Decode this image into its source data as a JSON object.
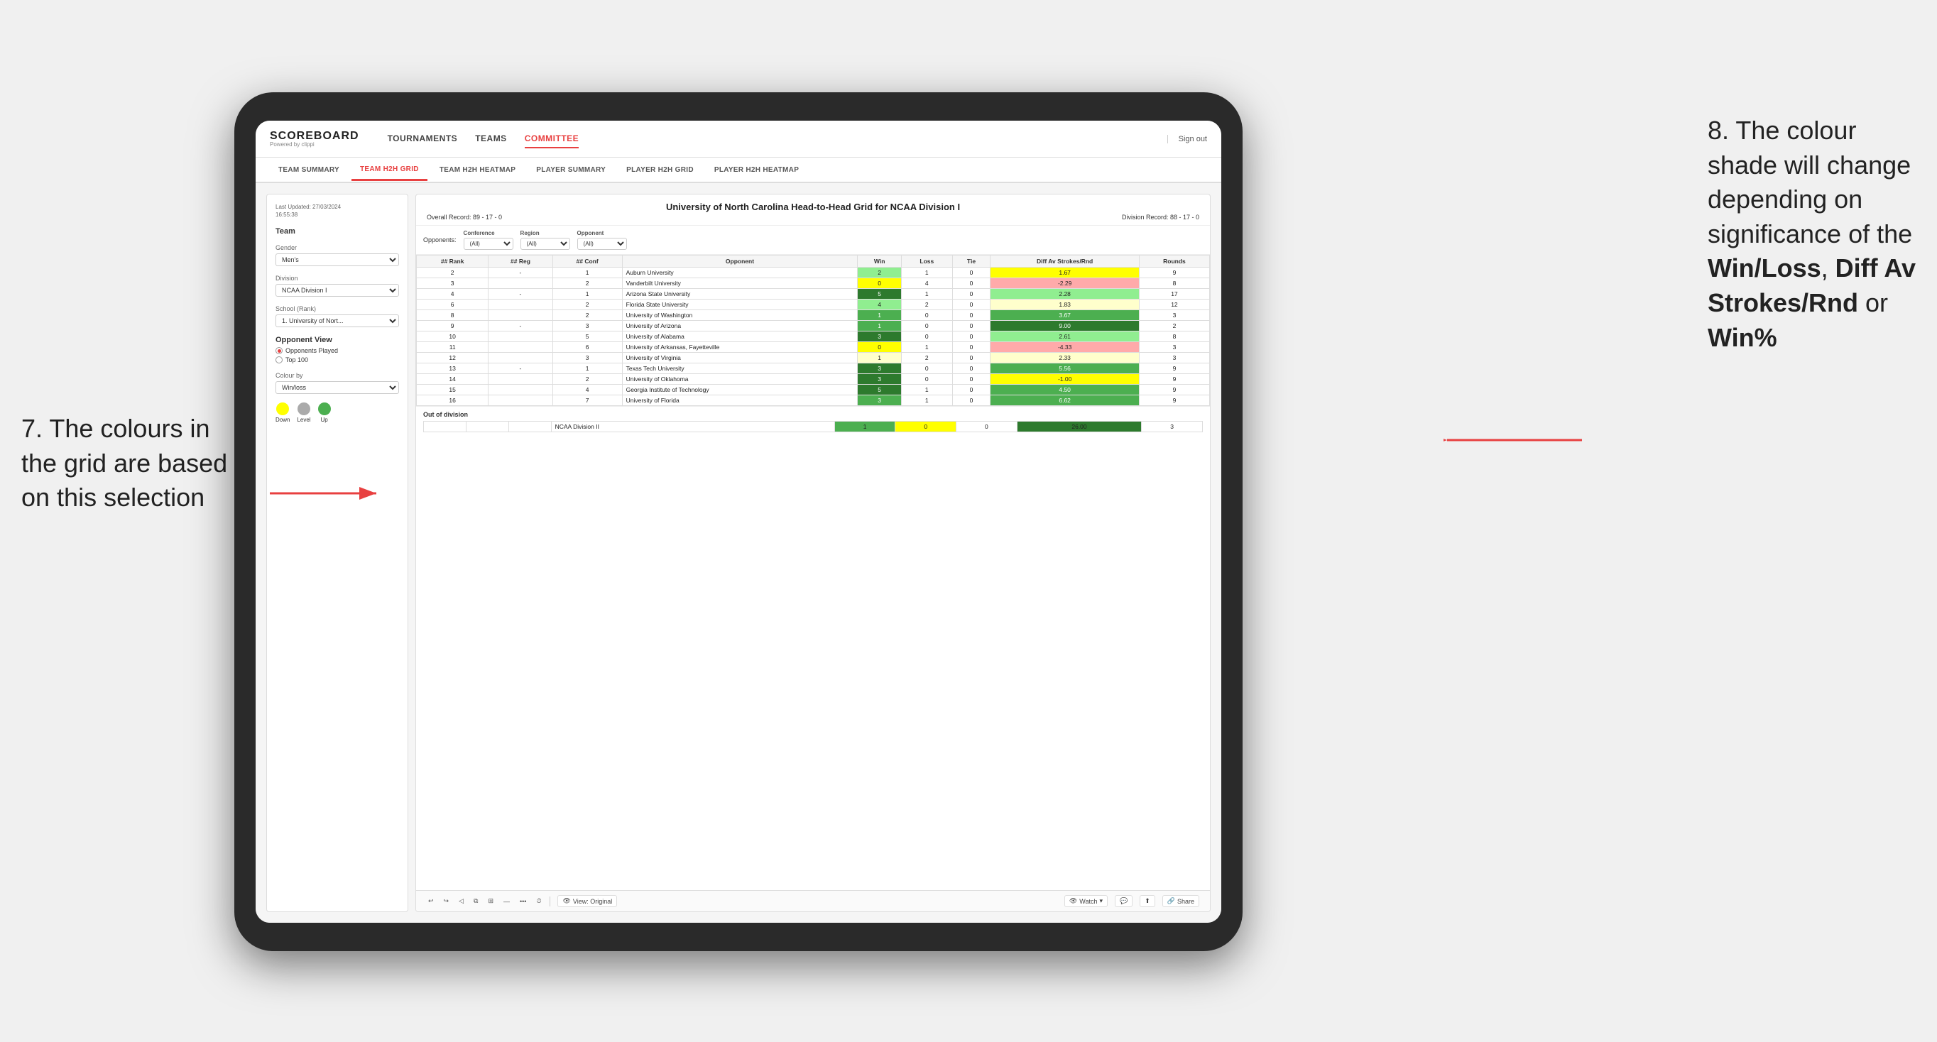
{
  "annotations": {
    "left": "7. The colours in\nthe grid are based\non this selection",
    "right_line1": "8. The colour\nshade will change\ndepending on\nsignificance of the",
    "right_bold1": "Win/Loss",
    "right_sep1": ", ",
    "right_bold2": "Diff Av\nStrokes/Rnd",
    "right_or": " or",
    "right_bold3": "Win%"
  },
  "nav": {
    "logo": "SCOREBOARD",
    "logo_sub": "Powered by clippi",
    "items": [
      "TOURNAMENTS",
      "TEAMS",
      "COMMITTEE"
    ],
    "active": "COMMITTEE",
    "sign_out": "Sign out"
  },
  "sub_tabs": {
    "items": [
      "TEAM SUMMARY",
      "TEAM H2H GRID",
      "TEAM H2H HEATMAP",
      "PLAYER SUMMARY",
      "PLAYER H2H GRID",
      "PLAYER H2H HEATMAP"
    ],
    "active": "TEAM H2H GRID"
  },
  "left_panel": {
    "last_updated_label": "Last Updated: 27/03/2024",
    "last_updated_time": "16:55:38",
    "team_label": "Team",
    "gender_label": "Gender",
    "gender_value": "Men's",
    "division_label": "Division",
    "division_value": "NCAA Division I",
    "school_label": "School (Rank)",
    "school_value": "1. University of Nort...",
    "opponent_view_label": "Opponent View",
    "radio1": "Opponents Played",
    "radio2": "Top 100",
    "colour_by_label": "Colour by",
    "colour_by_value": "Win/loss",
    "legend": {
      "down": "Down",
      "level": "Level",
      "up": "Up"
    }
  },
  "grid": {
    "title": "University of North Carolina Head-to-Head Grid for NCAA Division I",
    "overall_record": "Overall Record: 89 - 17 - 0",
    "division_record": "Division Record: 88 - 17 - 0",
    "opponents_label": "Opponents:",
    "conference_label": "Conference",
    "conference_value": "(All)",
    "region_label": "Region",
    "region_value": "(All)",
    "opponent_label": "Opponent",
    "opponent_value": "(All)",
    "columns": [
      "# Rank",
      "# Reg",
      "# Conf",
      "Opponent",
      "Win",
      "Loss",
      "Tie",
      "Diff Av Strokes/Rnd",
      "Rounds"
    ],
    "rows": [
      {
        "rank": "2",
        "reg": "-",
        "conf": "1",
        "opponent": "Auburn University",
        "win": "2",
        "loss": "1",
        "tie": "0",
        "diff": "1.67",
        "rounds": "9",
        "win_color": "green-light",
        "diff_color": "yellow"
      },
      {
        "rank": "3",
        "reg": "",
        "conf": "2",
        "opponent": "Vanderbilt University",
        "win": "0",
        "loss": "4",
        "tie": "0",
        "diff": "-2.29",
        "rounds": "8",
        "win_color": "yellow",
        "diff_color": "red"
      },
      {
        "rank": "4",
        "reg": "-",
        "conf": "1",
        "opponent": "Arizona State University",
        "win": "5",
        "loss": "1",
        "tie": "0",
        "diff": "2.28",
        "rounds": "17",
        "win_color": "dark-green",
        "diff_color": "green-light"
      },
      {
        "rank": "6",
        "reg": "",
        "conf": "2",
        "opponent": "Florida State University",
        "win": "4",
        "loss": "2",
        "tie": "0",
        "diff": "1.83",
        "rounds": "12",
        "win_color": "green-light",
        "diff_color": "yellow-light"
      },
      {
        "rank": "8",
        "reg": "",
        "conf": "2",
        "opponent": "University of Washington",
        "win": "1",
        "loss": "0",
        "tie": "0",
        "diff": "3.67",
        "rounds": "3",
        "win_color": "green",
        "diff_color": "green"
      },
      {
        "rank": "9",
        "reg": "-",
        "conf": "3",
        "opponent": "University of Arizona",
        "win": "1",
        "loss": "0",
        "tie": "0",
        "diff": "9.00",
        "rounds": "2",
        "win_color": "green",
        "diff_color": "dark-green"
      },
      {
        "rank": "10",
        "reg": "",
        "conf": "5",
        "opponent": "University of Alabama",
        "win": "3",
        "loss": "0",
        "tie": "0",
        "diff": "2.61",
        "rounds": "8",
        "win_color": "dark-green",
        "diff_color": "green-light"
      },
      {
        "rank": "11",
        "reg": "",
        "conf": "6",
        "opponent": "University of Arkansas, Fayetteville",
        "win": "0",
        "loss": "1",
        "tie": "0",
        "diff": "-4.33",
        "rounds": "3",
        "win_color": "yellow",
        "diff_color": "red"
      },
      {
        "rank": "12",
        "reg": "",
        "conf": "3",
        "opponent": "University of Virginia",
        "win": "1",
        "loss": "2",
        "tie": "0",
        "diff": "2.33",
        "rounds": "3",
        "win_color": "yellow-light",
        "diff_color": "yellow-light"
      },
      {
        "rank": "13",
        "reg": "-",
        "conf": "1",
        "opponent": "Texas Tech University",
        "win": "3",
        "loss": "0",
        "tie": "0",
        "diff": "5.56",
        "rounds": "9",
        "win_color": "dark-green",
        "diff_color": "green"
      },
      {
        "rank": "14",
        "reg": "",
        "conf": "2",
        "opponent": "University of Oklahoma",
        "win": "3",
        "loss": "0",
        "tie": "0",
        "diff": "-1.00",
        "rounds": "9",
        "win_color": "dark-green",
        "diff_color": "yellow"
      },
      {
        "rank": "15",
        "reg": "",
        "conf": "4",
        "opponent": "Georgia Institute of Technology",
        "win": "5",
        "loss": "1",
        "tie": "0",
        "diff": "4.50",
        "rounds": "9",
        "win_color": "dark-green",
        "diff_color": "green"
      },
      {
        "rank": "16",
        "reg": "",
        "conf": "7",
        "opponent": "University of Florida",
        "win": "3",
        "loss": "1",
        "tie": "0",
        "diff": "6.62",
        "rounds": "9",
        "win_color": "green",
        "diff_color": "green"
      }
    ],
    "out_of_division": {
      "label": "Out of division",
      "division": "NCAA Division II",
      "win": "1",
      "loss": "0",
      "tie": "0",
      "diff": "26.00",
      "rounds": "3"
    }
  },
  "toolbar": {
    "view_label": "View: Original",
    "watch_label": "Watch",
    "share_label": "Share"
  }
}
